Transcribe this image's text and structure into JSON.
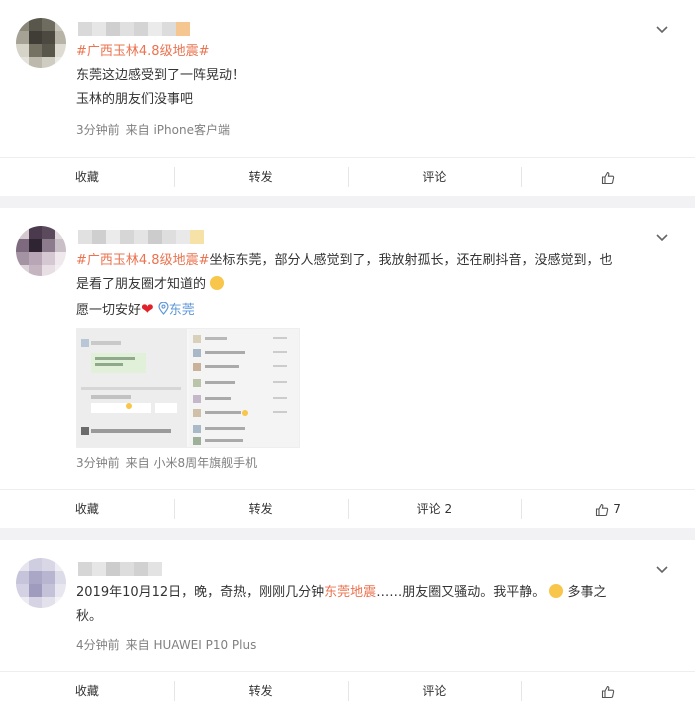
{
  "posts": [
    {
      "topic": "#广西玉林4.8级地震#",
      "lines": [
        "东莞这边感受到了一阵晃动！",
        "玉林的朋友们没事吧"
      ],
      "time": "3分钟前",
      "source": "来自 iPhone客户端",
      "actions": {
        "collect": "收藏",
        "repost": "转发",
        "comment": "评论",
        "like": ""
      }
    },
    {
      "topic": "#广西玉林4.8级地震#",
      "text_a": "坐标东莞，部分人感觉到了，我放射孤长，还在刷抖音，没感觉到，也",
      "text_b": "是看了朋友圈才知道的",
      "text_c": "愿一切安好",
      "location": "东莞",
      "time": "3分钟前",
      "source": "来自 小米8周年旗舰手机",
      "actions": {
        "collect": "收藏",
        "repost": "转发",
        "comment": "评论 2",
        "like": "7"
      }
    },
    {
      "text_a": "2019年10月12日，晚，奇热，刚刚几分钟",
      "highlight": "东莞地震",
      "text_b": "……朋友圈又骚动。我平静。",
      "text_c": "多事之",
      "text_d": "秋。",
      "time": "4分钟前",
      "source": "来自 HUAWEI P10 Plus",
      "actions": {
        "collect": "收藏",
        "repost": "转发",
        "comment": "评论",
        "like": ""
      }
    }
  ],
  "icons": {
    "chevron": "chevron-down-icon",
    "like": "thumbs-up-icon",
    "location": "location-pin-icon"
  },
  "colors": {
    "topic": "#eb7350",
    "location": "#5d97d8",
    "heart": "#e1222a",
    "background": "#f2f2f5"
  }
}
